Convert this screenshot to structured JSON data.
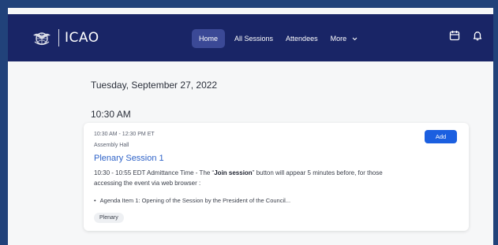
{
  "app": {
    "brand": "ICAO"
  },
  "nav": {
    "items": [
      {
        "label": "Home",
        "active": true
      },
      {
        "label": "All Sessions",
        "active": false
      },
      {
        "label": "Attendees",
        "active": false
      },
      {
        "label": "More",
        "active": false
      }
    ]
  },
  "header_icons": [
    "calendar-icon",
    "bell-icon"
  ],
  "schedule": {
    "date": "Tuesday, September 27, 2022",
    "time_slot": "10:30 AM",
    "sessions": [
      {
        "time_range": "10:30 AM - 12:30 PM ET",
        "location": "Assembly Hall",
        "title": "Plenary Session 1",
        "desc_before": "10:30 - 10:55 EDT Admittance Time - The “",
        "desc_bold": "Join session",
        "desc_after": "” button will appear 5 minutes before, for those accessing the event via web browser :",
        "agenda_item": "Agenda Item 1: Opening of the Session by the President of the Council...",
        "tag": "Plenary",
        "add_label": "Add"
      }
    ]
  },
  "colors": {
    "navbar": "#192566",
    "frame": "#21427a",
    "active_nav": "#3b4996",
    "link": "#2f63c8",
    "primary_button": "#1b5fe0",
    "page_bg": "#f6f7f8"
  }
}
